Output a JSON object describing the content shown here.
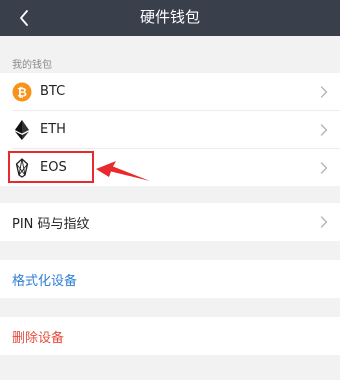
{
  "header": {
    "title": "硬件钱包",
    "back_icon": "chevron-left-icon"
  },
  "wallets_section": {
    "label": "我的钱包",
    "items": [
      {
        "label": "BTC",
        "icon": "bitcoin-icon",
        "color": "#f7931a"
      },
      {
        "label": "ETH",
        "icon": "ethereum-icon",
        "color": "#222222"
      },
      {
        "label": "EOS",
        "icon": "eos-icon",
        "color": "#222222"
      }
    ]
  },
  "pin": {
    "label": "PIN 码与指纹"
  },
  "format": {
    "label": "格式化设备",
    "color": "#2f7fd6"
  },
  "delete": {
    "label": "删除设备",
    "color": "#e64d3c"
  },
  "annotation": {
    "color": "#e8292e"
  }
}
